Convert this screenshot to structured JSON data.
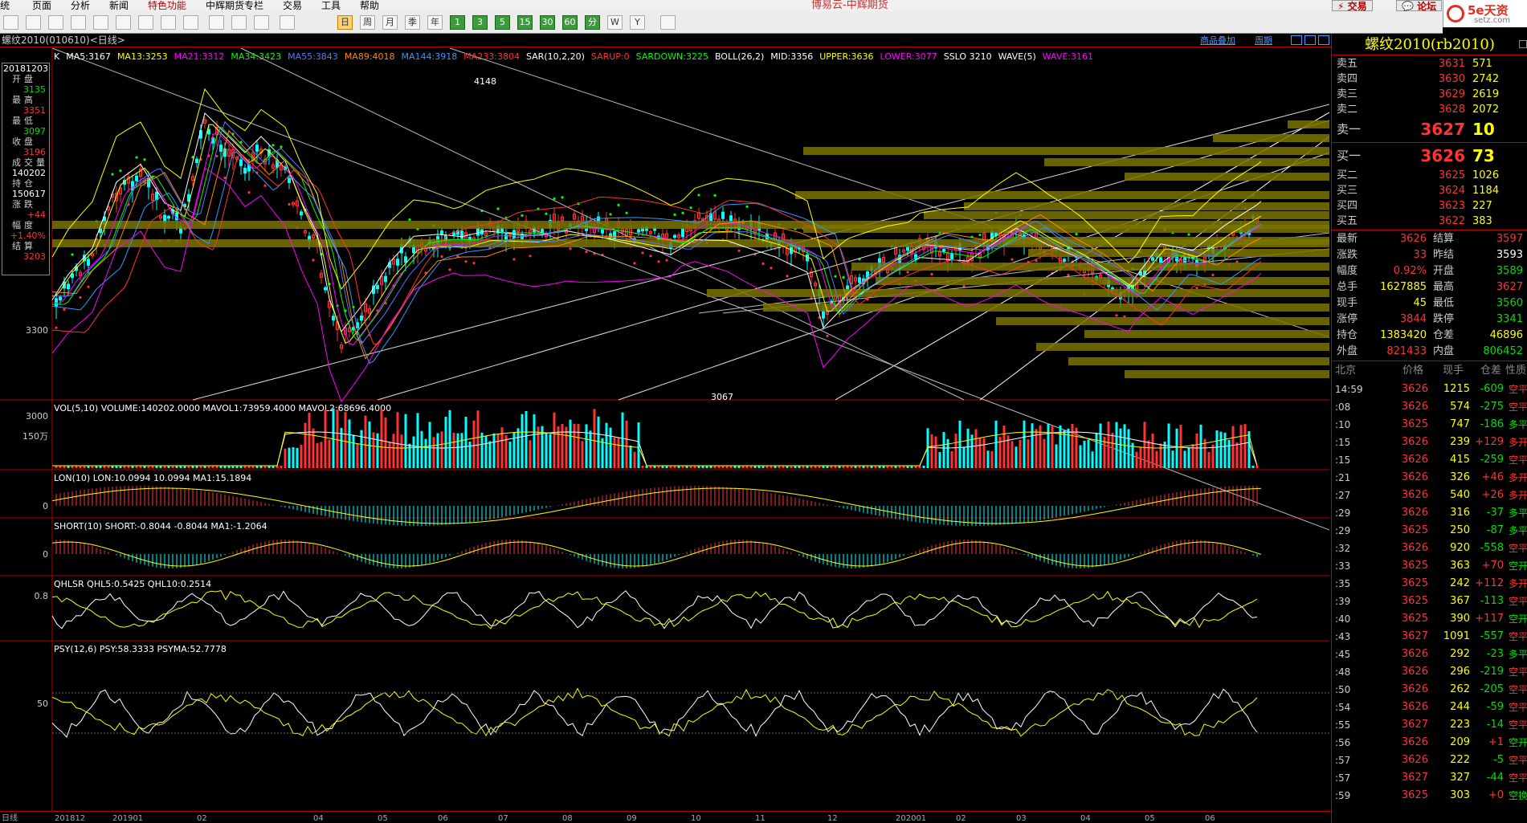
{
  "app": {
    "title": "博易云-中辉期货",
    "trade": "交易",
    "forum": "论坛",
    "logo_main": "5e天资",
    "logo_sub": "setz.com"
  },
  "menu": [
    "统",
    "页面",
    "分析",
    "新闻",
    "特色功能",
    "中辉期货专栏",
    "交易",
    "工具",
    "帮助"
  ],
  "toolbar": {
    "period_buttons": [
      "日",
      "周",
      "月",
      "季",
      "年",
      "1",
      "3",
      "5",
      "15",
      "30",
      "60",
      "分",
      "W",
      "Y"
    ]
  },
  "chart": {
    "title": "螺纹2010(010610)<日线>",
    "link_overlay": "商品叠加",
    "link_period": "周期",
    "k_label": "K",
    "ma": [
      {
        "t": "MA5:3167",
        "c": "#ffffff"
      },
      {
        "t": "MA13:3253",
        "c": "#ffff00"
      },
      {
        "t": "MA21:3312",
        "c": "#ff00ff"
      },
      {
        "t": "MA34:3423",
        "c": "#00ff00"
      },
      {
        "t": "MA55:3843",
        "c": "#5577ff"
      },
      {
        "t": "MA89:4018",
        "c": "#ff8800"
      },
      {
        "t": "MA144:3918",
        "c": "#3399ff"
      },
      {
        "t": "MA233:3804",
        "c": "#ff3333"
      },
      {
        "t": "SAR(10,2,20)",
        "c": "#ffffff"
      },
      {
        "t": "SARUP:0",
        "c": "#ff3333"
      },
      {
        "t": "SARDOWN:3225",
        "c": "#00ff00"
      },
      {
        "t": "BOLL(26,2)",
        "c": "#ffffff"
      },
      {
        "t": "MID:3356",
        "c": "#ffffff"
      },
      {
        "t": "UPPER:3636",
        "c": "#ffff00"
      },
      {
        "t": "LOWER:3077",
        "c": "#ff00ff"
      },
      {
        "t": "SSLO 3210",
        "c": "#ffffff"
      },
      {
        "t": "WAVE(5)",
        "c": "#ffffff"
      },
      {
        "t": "WAVE:3161",
        "c": "#ff00ff"
      }
    ],
    "price_labels": [
      "3300",
      "3000"
    ],
    "marks": [
      "4148",
      "3067"
    ],
    "info": {
      "date": "20181203",
      "rows": [
        {
          "k": "开盘",
          "v": "3135",
          "c": "grn"
        },
        {
          "k": "最高",
          "v": "3351",
          "c": "red"
        },
        {
          "k": "最低",
          "v": "3097",
          "c": "grn"
        },
        {
          "k": "收盘",
          "v": "3196",
          "c": "red"
        },
        {
          "k": "成交量",
          "v": "140202",
          "c": "wht"
        },
        {
          "k": "持仓",
          "v": "150617",
          "c": "wht"
        },
        {
          "k": "涨跌",
          "v": "+44",
          "c": "red"
        },
        {
          "k": "幅度",
          "v": "+1.40%",
          "c": "red"
        },
        {
          "k": "结算",
          "v": "3203",
          "c": "red"
        }
      ]
    },
    "subcharts": [
      {
        "label": "VOL(5,10) VOLUME:140202.0000 MAVOL1:73959.4000 MAVOL2:68696.4000",
        "y": "150万"
      },
      {
        "label": "LON(10) LON:10.0994 10.0994 MA1:15.1894",
        "y": "0"
      },
      {
        "label": "SHORT(10) SHORT:-0.8044 -0.8044 MA1:-1.2064",
        "y": "0"
      },
      {
        "label": "QHLSR QHL5:0.5425 QHL10:0.2514",
        "y": "0.8"
      },
      {
        "label": "PSY(12,6) PSY:58.3333 PSYMA:52.7778",
        "y": "50"
      }
    ],
    "xaxis": [
      "日线",
      "201812",
      "201901",
      "02",
      "04",
      "05",
      "06",
      "07",
      "08",
      "09",
      "10",
      "11",
      "12",
      "202001",
      "02",
      "03",
      "04",
      "05",
      "06"
    ]
  },
  "quote": {
    "title": "螺纹2010(rb2010)",
    "asks": [
      {
        "k": "卖五",
        "p": "3631",
        "q": "571"
      },
      {
        "k": "卖四",
        "p": "3630",
        "q": "2742"
      },
      {
        "k": "卖三",
        "p": "3629",
        "q": "2619"
      },
      {
        "k": "卖二",
        "p": "3628",
        "q": "2072"
      },
      {
        "k": "卖一",
        "p": "3627",
        "q": "10"
      }
    ],
    "bids": [
      {
        "k": "买一",
        "p": "3626",
        "q": "73"
      },
      {
        "k": "买二",
        "p": "3625",
        "q": "1026"
      },
      {
        "k": "买三",
        "p": "3624",
        "q": "1184"
      },
      {
        "k": "买四",
        "p": "3623",
        "q": "227"
      },
      {
        "k": "买五",
        "p": "3622",
        "q": "383"
      }
    ],
    "stats": [
      {
        "k1": "最新",
        "v1": "3626",
        "c1": "red",
        "k2": "结算",
        "v2": "3597",
        "c2": "red"
      },
      {
        "k1": "涨跌",
        "v1": "33",
        "c1": "red",
        "k2": "昨结",
        "v2": "3593",
        "c2": "wht"
      },
      {
        "k1": "幅度",
        "v1": "0.92%",
        "c1": "red",
        "k2": "开盘",
        "v2": "3589",
        "c2": "grn"
      },
      {
        "k1": "总手",
        "v1": "1627885",
        "c1": "yel",
        "k2": "最高",
        "v2": "3627",
        "c2": "red"
      },
      {
        "k1": "现手",
        "v1": "45",
        "c1": "yel",
        "k2": "最低",
        "v2": "3560",
        "c2": "grn"
      },
      {
        "k1": "涨停",
        "v1": "3844",
        "c1": "red",
        "k2": "跌停",
        "v2": "3341",
        "c2": "grn"
      },
      {
        "k1": "持仓",
        "v1": "1383420",
        "c1": "yel",
        "k2": "仓差",
        "v2": "46896",
        "c2": "yel"
      },
      {
        "k1": "外盘",
        "v1": "821433",
        "c1": "red",
        "k2": "内盘",
        "v2": "806452",
        "c2": "grn"
      }
    ],
    "ticks_header": {
      "c1": "北京",
      "c2": "价格",
      "c3": "现手",
      "c4": "仓差",
      "c5": "性质"
    },
    "ticks": [
      {
        "t": "14:59",
        "p": "3626",
        "v": "1215",
        "c": "-609",
        "n": "空平",
        "nc": "red"
      },
      {
        "t": ":08",
        "p": "3626",
        "v": "574",
        "c": "-275",
        "n": "空平",
        "nc": "red"
      },
      {
        "t": ":10",
        "p": "3625",
        "v": "747",
        "c": "-186",
        "n": "多平",
        "nc": "grn"
      },
      {
        "t": ":15",
        "p": "3626",
        "v": "239",
        "c": "+129",
        "n": "多开",
        "nc": "red"
      },
      {
        "t": ":15",
        "p": "3626",
        "v": "415",
        "c": "-259",
        "n": "空平",
        "nc": "red"
      },
      {
        "t": ":21",
        "p": "3626",
        "v": "326",
        "c": "+46",
        "n": "多开",
        "nc": "red"
      },
      {
        "t": ":27",
        "p": "3626",
        "v": "540",
        "c": "+26",
        "n": "多开",
        "nc": "red"
      },
      {
        "t": ":29",
        "p": "3626",
        "v": "316",
        "c": "-37",
        "n": "多平",
        "nc": "grn"
      },
      {
        "t": ":29",
        "p": "3625",
        "v": "250",
        "c": "-87",
        "n": "多平",
        "nc": "grn"
      },
      {
        "t": ":32",
        "p": "3626",
        "v": "920",
        "c": "-558",
        "n": "空平",
        "nc": "red"
      },
      {
        "t": ":33",
        "p": "3625",
        "v": "363",
        "c": "+70",
        "n": "空开",
        "nc": "grn"
      },
      {
        "t": ":35",
        "p": "3625",
        "v": "242",
        "c": "+112",
        "n": "多开",
        "nc": "red"
      },
      {
        "t": ":39",
        "p": "3625",
        "v": "367",
        "c": "-113",
        "n": "空平",
        "nc": "red"
      },
      {
        "t": ":40",
        "p": "3625",
        "v": "390",
        "c": "+117",
        "n": "空开",
        "nc": "grn"
      },
      {
        "t": ":43",
        "p": "3627",
        "v": "1091",
        "c": "-557",
        "n": "空平",
        "nc": "red"
      },
      {
        "t": ":45",
        "p": "3626",
        "v": "292",
        "c": "-23",
        "n": "多平",
        "nc": "grn"
      },
      {
        "t": ":48",
        "p": "3626",
        "v": "296",
        "c": "-219",
        "n": "空平",
        "nc": "red"
      },
      {
        "t": ":50",
        "p": "3626",
        "v": "262",
        "c": "-205",
        "n": "空平",
        "nc": "red"
      },
      {
        "t": ":54",
        "p": "3626",
        "v": "244",
        "c": "-59",
        "n": "空平",
        "nc": "red"
      },
      {
        "t": ":55",
        "p": "3627",
        "v": "223",
        "c": "-14",
        "n": "空平",
        "nc": "red"
      },
      {
        "t": ":56",
        "p": "3626",
        "v": "209",
        "c": "+1",
        "n": "空开",
        "nc": "grn"
      },
      {
        "t": ":57",
        "p": "3626",
        "v": "222",
        "c": "-5",
        "n": "空平",
        "nc": "red"
      },
      {
        "t": ":57",
        "p": "3627",
        "v": "327",
        "c": "-44",
        "n": "空平",
        "nc": "red"
      },
      {
        "t": ":59",
        "p": "3625",
        "v": "303",
        "c": "+0",
        "n": "空换",
        "nc": "grn"
      }
    ]
  }
}
